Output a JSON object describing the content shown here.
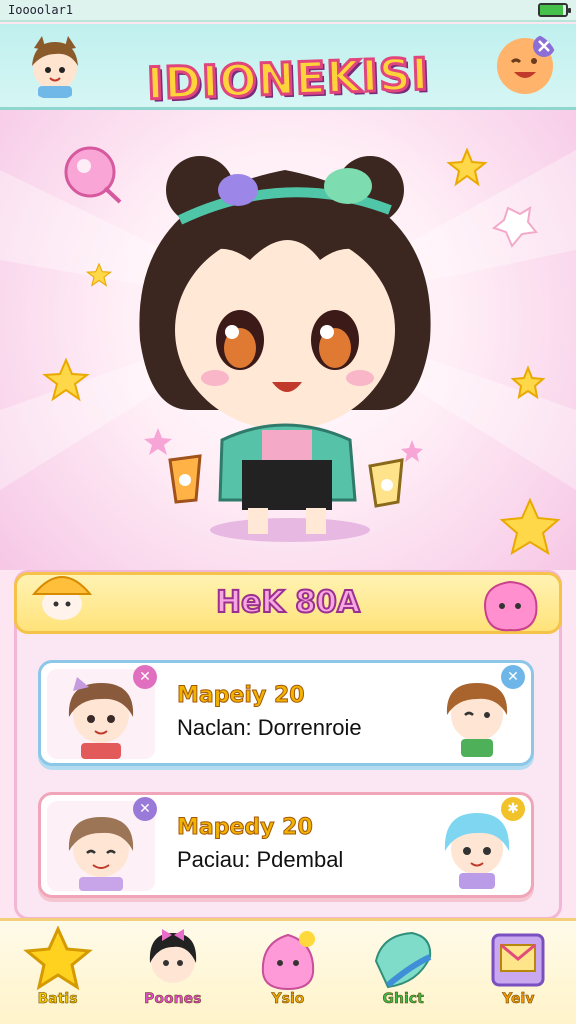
{
  "status": {
    "text": "Ioooolar1",
    "battery_level": 0.9
  },
  "header": {
    "title": "IDIONEKISI"
  },
  "panel": {
    "title": "HeK 80A"
  },
  "cards": [
    {
      "name": "Mapeiy 20",
      "desc": "Naclan: Dorrenroie"
    },
    {
      "name": "Mapedy 20",
      "desc": "Paciau: Pdembal"
    }
  ],
  "nav": [
    {
      "label": "Batis",
      "color": "#f6c800",
      "icon": "star-icon"
    },
    {
      "label": "Poones",
      "color": "#e24cd0",
      "icon": "avatar-icon"
    },
    {
      "label": "Ysio",
      "color": "#f0a800",
      "icon": "blob-icon"
    },
    {
      "label": "Ghict",
      "color": "#3dbb4a",
      "icon": "gem-icon"
    },
    {
      "label": "Yeiv",
      "color": "#f29a00",
      "icon": "mail-icon"
    }
  ]
}
